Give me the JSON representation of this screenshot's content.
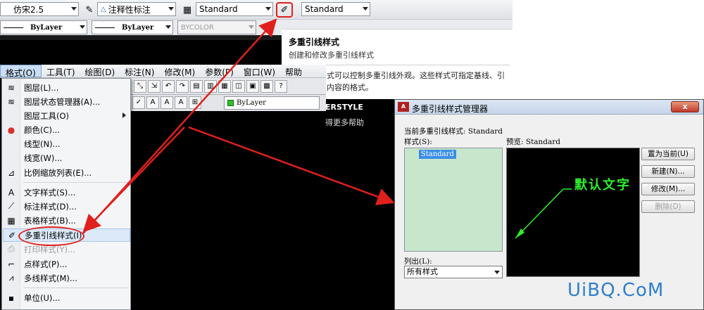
{
  "toolbar": {
    "font_combo": "仿宋2.5",
    "dim_style_combo": "注释性标注",
    "table_style_combo": "Standard",
    "mleader_style_combo": "Standard",
    "linetype_combo": "ByLayer",
    "lineweight_combo": "ByLayer",
    "color_combo": "BYCOLOR"
  },
  "tooltip": {
    "title": "多重引线样式",
    "subtitle": "创建和修改多重引线样式",
    "body": "式可以控制多重引线外观。这些样式可指定基线、引 内容的格式。",
    "command_fragment": "ERSTYLE",
    "help_fragment": "得更多帮助"
  },
  "menubar": {
    "items": [
      "格式(O)",
      "工具(T)",
      "绘图(D)",
      "标注(N)",
      "修改(M)",
      "参数(P)",
      "窗口(W)",
      "帮助"
    ]
  },
  "toolbar3": {
    "layer_combo": "ByLayer"
  },
  "format_menu": {
    "items": [
      {
        "label": "图层(L)...",
        "icon": "layer-icon"
      },
      {
        "label": "图层状态管理器(A)...",
        "icon": "layer-state-icon"
      },
      {
        "label": "图层工具(O)",
        "icon": "",
        "submenu": true
      },
      {
        "label": "颜色(C)...",
        "icon": "color-wheel-icon"
      },
      {
        "label": "线型(N)...",
        "icon": ""
      },
      {
        "label": "线宽(W)...",
        "icon": ""
      },
      {
        "label": "比例缩放列表(E)...",
        "icon": "scale-list-icon"
      },
      {
        "label": "文字样式(S)...",
        "icon": "text-style-icon"
      },
      {
        "label": "标注样式(D)...",
        "icon": "dim-style-icon"
      },
      {
        "label": "表格样式(B)...",
        "icon": "table-style-icon"
      },
      {
        "label": "多重引线样式(I)",
        "icon": "mleader-style-icon",
        "highlighted": true
      },
      {
        "label": "打印样式(Y)...",
        "icon": "print-style-icon",
        "disabled": true
      },
      {
        "label": "点样式(P)...",
        "icon": "point-style-icon"
      },
      {
        "label": "多线样式(M)...",
        "icon": "mline-style-icon"
      },
      {
        "label": "单位(U)...",
        "icon": "units-icon"
      }
    ]
  },
  "dialog": {
    "title": "多重引线样式管理器",
    "close_label": "x",
    "current_style": "当前多重引线样式: Standard",
    "styles_label": "样式(S):",
    "preview_label": "预览: Standard",
    "style_items": [
      "Standard"
    ],
    "preview_text": "默认文字",
    "list_label": "列出(L):",
    "list_value": "所有样式",
    "buttons": {
      "set_current": "置为当前(U)",
      "new": "新建(N)...",
      "modify": "修改(M)...",
      "delete": "删除(D)"
    }
  },
  "watermark": "UiBQ.CoM",
  "colors": {
    "annotation_red": "#e0201c",
    "preview_green": "#2cf02c",
    "list_bg": "#c7e7cc"
  }
}
